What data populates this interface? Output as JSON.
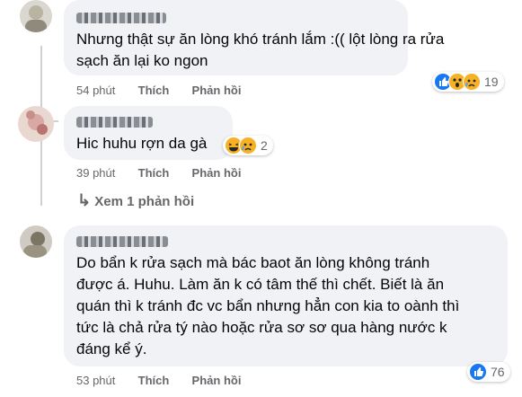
{
  "comments": [
    {
      "lines": [
        "Nhưng thật sự ăn lòng khó tránh lắm :(( lột lòng ra rửa",
        "sạch ăn lại ko ngon"
      ],
      "time": "54 phút",
      "like": "Thích",
      "reply": "Phản hồi",
      "reactions": [
        "like-icon",
        "wow-icon",
        "sad-icon"
      ],
      "count": "19"
    },
    {
      "lines": [
        "Hic huhu rợn da gà"
      ],
      "time": "39 phút",
      "like": "Thích",
      "reply": "Phản hồi",
      "reactions": [
        "haha-icon",
        "sad-icon"
      ],
      "count": "2"
    },
    {
      "lines": [
        "Do bẩn k rửa sạch mà bác baot ăn lòng không tránh",
        "được á. Huhu. Làm ăn k có tâm thế thì chết. Biết là ăn",
        "quán thì k tránh đc vc bẩn nhưng hẳn con kia to oành thì",
        "tức là chả rửa tý nào hoặc rửa sơ sơ qua hàng nước k",
        "đáng kể ý."
      ],
      "time": "53 phút",
      "like": "Thích",
      "reply": "Phản hồi",
      "reactions": [
        "like-icon"
      ],
      "count": "76"
    }
  ],
  "view_replies": {
    "arrow": "↳",
    "label": "Xem 1 phản hồi"
  },
  "colors": {
    "bubble": "#f0f2f5",
    "meta": "#65676b",
    "like": "#1877f2",
    "emoji": "#f7b125"
  }
}
